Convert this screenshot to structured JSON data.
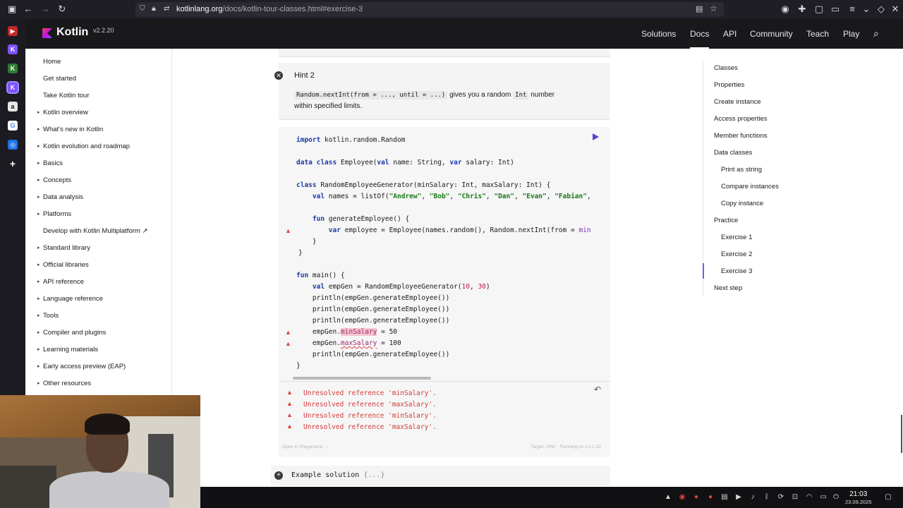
{
  "browser": {
    "url_domain": "kotlinlang.org",
    "url_path": "/docs/kotlin-tour-classes.html#exercise-3"
  },
  "header": {
    "brand": "Kotlin",
    "version": "v2.2.20",
    "nav": [
      "Solutions",
      "Docs",
      "API",
      "Community",
      "Teach",
      "Play"
    ],
    "active_nav": "Docs"
  },
  "sidebar": {
    "items": [
      {
        "label": "Home",
        "caret": false
      },
      {
        "label": "Get started",
        "caret": false
      },
      {
        "label": "Take Kotlin tour",
        "caret": false
      },
      {
        "label": "Kotlin overview",
        "caret": true
      },
      {
        "label": "What's new in Kotlin",
        "caret": true
      },
      {
        "label": "Kotlin evolution and roadmap",
        "caret": true
      },
      {
        "label": "Basics",
        "caret": true
      },
      {
        "label": "Concepts",
        "caret": true
      },
      {
        "label": "Data analysis",
        "caret": true
      },
      {
        "label": "Platforms",
        "caret": true
      },
      {
        "label": "Develop with Kotlin Multiplatform ↗",
        "caret": false
      },
      {
        "label": "Standard library",
        "caret": true
      },
      {
        "label": "Official libraries",
        "caret": true
      },
      {
        "label": "API reference",
        "caret": true
      },
      {
        "label": "Language reference",
        "caret": true
      },
      {
        "label": "Tools",
        "caret": true
      },
      {
        "label": "Compiler and plugins",
        "caret": true
      },
      {
        "label": "Learning materials",
        "caret": true
      },
      {
        "label": "Early access preview (EAP)",
        "caret": true
      },
      {
        "label": "Other resources",
        "caret": true
      }
    ]
  },
  "hint": {
    "title": "Hint 2",
    "code": "Random.nextInt(from = ..., until = ...)",
    "text_mid": " gives you a random ",
    "code2": "Int",
    "text_end": " number",
    "line2": "within specified limits."
  },
  "code_lines": {
    "l1": "import kotlin.random.Random",
    "l3": "data class Employee(val name: String, var salary: Int)",
    "l5": "class RandomEmployeeGenerator(minSalary: Int, maxSalary: Int) {",
    "l6a": "    val names = listOf(",
    "l6s": [
      "\"Andrew\"",
      "\"Bob\"",
      "\"Chris\"",
      "\"Dan\"",
      "\"Evan\"",
      "\"Fabian\""
    ],
    "l8": "    fun generateEmployee() {",
    "l9": "        var employee = Employee(names.random(), Random.nextInt(from = min",
    "l10": "    }",
    "l11": "}",
    "l13": "fun main() {",
    "l14": "    val empGen = RandomEmployeeGenerator(10, 30)",
    "l15": "    println(empGen.generateEmployee())",
    "l16": "    println(empGen.generateEmployee())",
    "l17": "    println(empGen.generateEmployee())",
    "l18a": "    empGen.",
    "l18b": "minSalary",
    "l18c": " = 50",
    "l19a": "    empGen.",
    "l19b": "maxSalary",
    "l19c": " = 100",
    "l20": "    println(empGen.generateEmployee())",
    "l21": "}"
  },
  "output": {
    "lines": [
      "Unresolved reference 'minSalary'.",
      "Unresolved reference 'maxSalary'.",
      "Unresolved reference 'minSalary'.",
      "Unresolved reference 'maxSalary'."
    ],
    "open_playground": "Open in Playground →",
    "target": "Target: JVM",
    "running_on": "Running on v.2.2.20"
  },
  "solution": {
    "label": "Example solution",
    "collapsed": " {...}"
  },
  "toc": {
    "items": [
      {
        "label": "Classes",
        "indent": false
      },
      {
        "label": "Properties",
        "indent": false
      },
      {
        "label": "Create instance",
        "indent": false
      },
      {
        "label": "Access properties",
        "indent": false
      },
      {
        "label": "Member functions",
        "indent": false
      },
      {
        "label": "Data classes",
        "indent": false
      },
      {
        "label": "Print as string",
        "indent": true
      },
      {
        "label": "Compare instances",
        "indent": true
      },
      {
        "label": "Copy instance",
        "indent": true
      },
      {
        "label": "Practice",
        "indent": false
      },
      {
        "label": "Exercise 1",
        "indent": true
      },
      {
        "label": "Exercise 2",
        "indent": true
      },
      {
        "label": "Exercise 3",
        "indent": true
      },
      {
        "label": "Next step",
        "indent": false
      }
    ],
    "active": "Exercise 3"
  },
  "taskbar": {
    "time": "21:03",
    "date": "23.09.2025"
  },
  "colors": {
    "accent": "#7f52ff",
    "error": "#e04343",
    "header_bg": "#19191c"
  }
}
